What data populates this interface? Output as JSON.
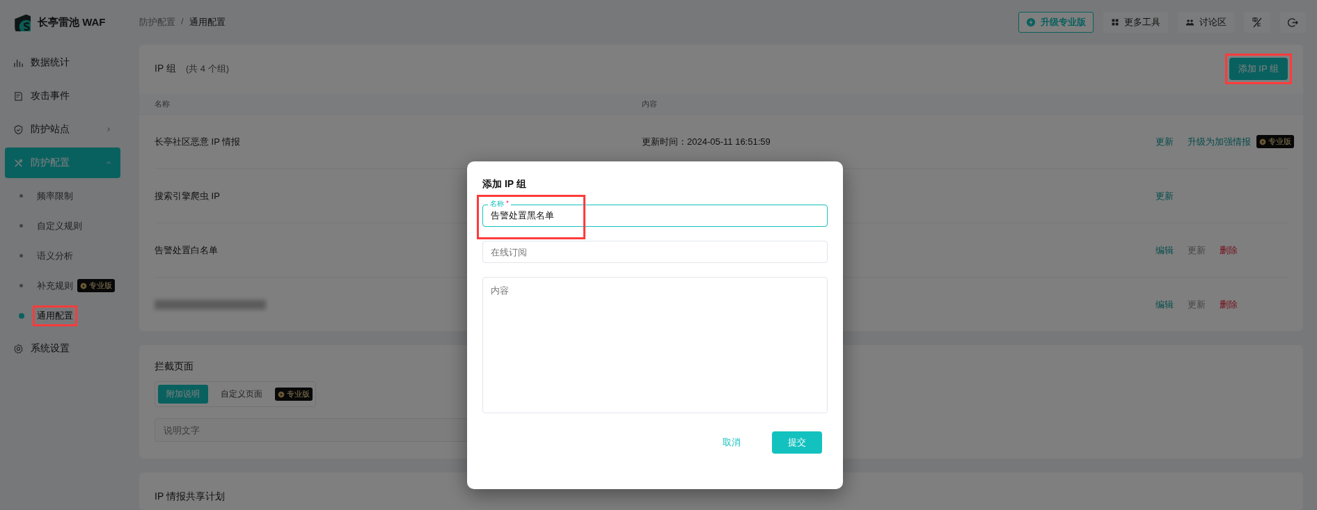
{
  "app": {
    "name": "长亭雷池 WAF"
  },
  "breadcrumb": {
    "separator": "/",
    "items": [
      {
        "label": "防护配置"
      },
      {
        "label": "通用配置"
      }
    ]
  },
  "toolbar": [
    {
      "kind": "upgrade",
      "label": "升级专业版"
    },
    {
      "kind": "tools",
      "label": "更多工具"
    },
    {
      "kind": "forum",
      "label": "讨论区"
    },
    {
      "kind": "language"
    },
    {
      "kind": "logout"
    }
  ],
  "sidebar": {
    "items": [
      {
        "kind": "item",
        "label": "数据统计",
        "selected": false
      },
      {
        "kind": "item",
        "label": "攻击事件",
        "selected": false
      },
      {
        "kind": "group",
        "label": "防护站点",
        "selected": false,
        "expanded": false
      },
      {
        "kind": "group",
        "label": "防护配置",
        "selected": true,
        "expanded": true,
        "children": [
          {
            "label": "频率限制",
            "selected": false
          },
          {
            "label": "自定义规则",
            "selected": false
          },
          {
            "label": "语义分析",
            "selected": false
          },
          {
            "label": "补充规则",
            "selected": false,
            "badge": "专业版"
          },
          {
            "label": "通用配置",
            "selected": true,
            "highlighted": true
          }
        ]
      },
      {
        "kind": "item",
        "label": "系统设置",
        "selected": false
      }
    ]
  },
  "ip_groups": {
    "title": "IP 组",
    "count": "(共 4 个组)",
    "add_button": {
      "label": "添加 IP 组",
      "highlighted": true
    },
    "columns": [
      "名称",
      "内容"
    ],
    "rows": [
      {
        "name": "长亭社区恶意 IP 情报",
        "content": "更新时间：2024-05-11 16:51:59",
        "actions": [
          {
            "kind": "link",
            "label": "更新",
            "disabled": false
          },
          {
            "kind": "link",
            "label": "升级为加强情报",
            "disabled": false,
            "badge": "专业版"
          }
        ]
      },
      {
        "name": "搜索引擎爬虫 IP",
        "actions": [
          {
            "kind": "link",
            "label": "更新",
            "disabled": false
          }
        ]
      },
      {
        "name": "告警处置白名单",
        "actions": [
          {
            "kind": "link",
            "label": "编辑",
            "disabled": false
          },
          {
            "kind": "link",
            "label": "更新",
            "disabled": true
          },
          {
            "kind": "danger",
            "label": "删除",
            "disabled": false
          }
        ]
      },
      {
        "blurred": true,
        "actions": [
          {
            "kind": "link",
            "label": "编辑",
            "disabled": false
          },
          {
            "kind": "link",
            "label": "更新",
            "disabled": true
          },
          {
            "kind": "danger",
            "label": "删除",
            "disabled": false
          }
        ]
      }
    ]
  },
  "block_page": {
    "title": "拦截页面",
    "modes": [
      {
        "label": "附加说明",
        "selected": true
      },
      {
        "label": "自定义页面",
        "selected": false,
        "badge": "专业版"
      }
    ],
    "description": {
      "placeholder": "说明文字"
    }
  },
  "sharing": {
    "title": "IP 情报共享计划"
  },
  "dialog": {
    "title": "添加 IP 组",
    "fields": [
      {
        "kind": "input",
        "label": "名称",
        "required_mark": "*",
        "value": "告警处置黑名单",
        "focused": true,
        "highlighted": true
      },
      {
        "kind": "input",
        "placeholder": "在线订阅",
        "focused": false
      },
      {
        "kind": "textarea",
        "placeholder": "内容",
        "focused": false
      }
    ],
    "buttons": [
      {
        "kind": "text",
        "label": "取消"
      },
      {
        "kind": "primary",
        "label": "提交"
      }
    ]
  }
}
